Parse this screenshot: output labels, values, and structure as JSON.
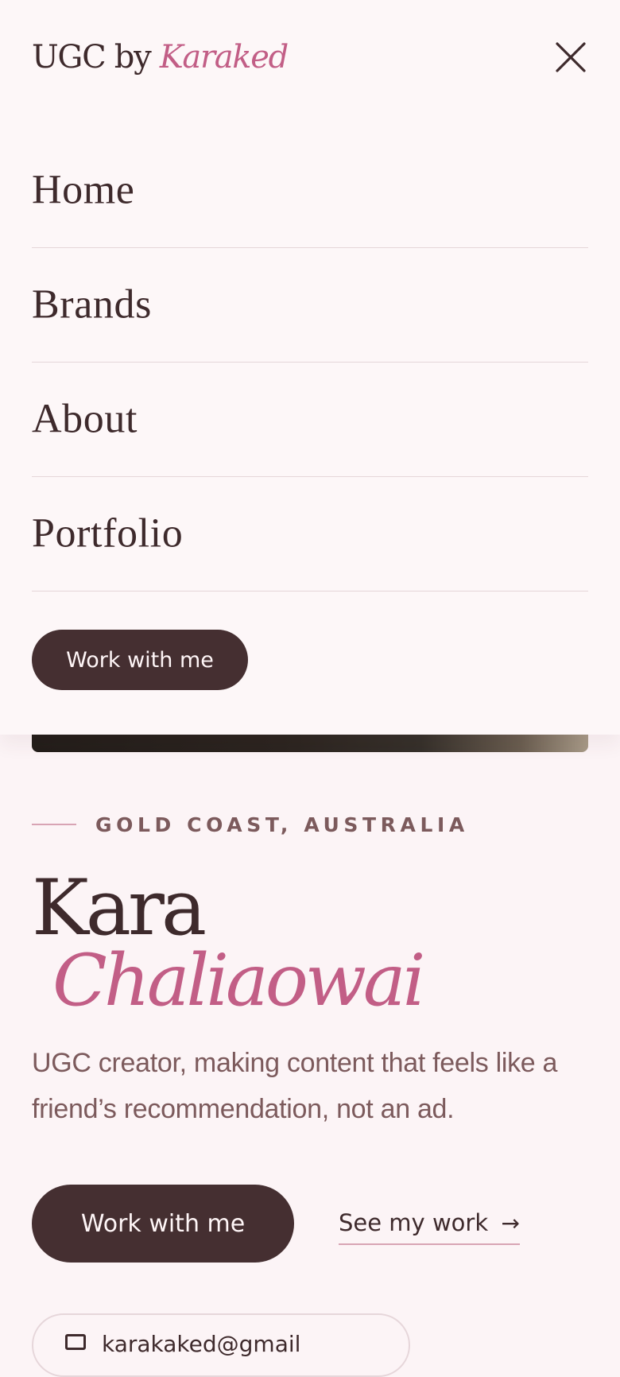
{
  "header": {
    "brand_prefix": "UGC by",
    "brand_accent": "Karaked",
    "close_icon": "close-icon"
  },
  "menu": {
    "items": [
      {
        "label": "Home"
      },
      {
        "label": "Brands"
      },
      {
        "label": "About"
      },
      {
        "label": "Portfolio"
      }
    ],
    "cta_label": "Work with me"
  },
  "hero": {
    "location": "GOLD COAST, AUSTRALIA",
    "first_name": "Kara",
    "last_name": "Chaliaowai",
    "tagline": "UGC creator, making content that feels like a friend’s recommendation, not an ad.",
    "cta_label": "Work with me",
    "secondary_label": "See my work",
    "secondary_arrow": "→",
    "email_icon": "mail-icon",
    "email_text": "karakaked@gmail"
  },
  "colors": {
    "background": "#fcf4f6",
    "text": "#3e2a2c",
    "accent": "#c25e86",
    "muted": "#7c5a5c",
    "button": "#452f31"
  }
}
